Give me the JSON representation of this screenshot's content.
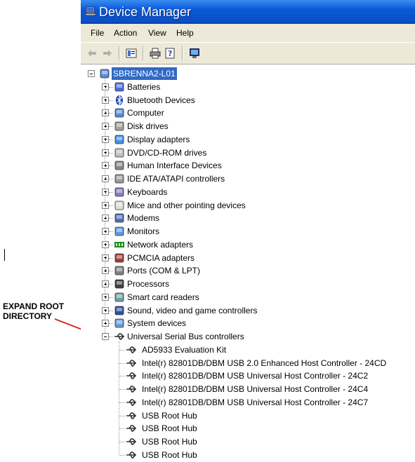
{
  "window": {
    "title": "Device Manager"
  },
  "menu": [
    "File",
    "Action",
    "View",
    "Help"
  ],
  "toolbar": [
    "back",
    "forward",
    "properties",
    "print",
    "help",
    "scan"
  ],
  "tree": {
    "root": "SBRENNA2-L01",
    "categories": [
      {
        "label": "Batteries",
        "icon": "battery-icon"
      },
      {
        "label": "Bluetooth Devices",
        "icon": "bluetooth-icon"
      },
      {
        "label": "Computer",
        "icon": "computer-icon"
      },
      {
        "label": "Disk drives",
        "icon": "disk-icon"
      },
      {
        "label": "Display adapters",
        "icon": "display-icon"
      },
      {
        "label": "DVD/CD-ROM drives",
        "icon": "dvd-icon"
      },
      {
        "label": "Human Interface Devices",
        "icon": "hid-icon"
      },
      {
        "label": "IDE ATA/ATAPI controllers",
        "icon": "ide-icon"
      },
      {
        "label": "Keyboards",
        "icon": "keyboard-icon"
      },
      {
        "label": "Mice and other pointing devices",
        "icon": "mouse-icon"
      },
      {
        "label": "Modems",
        "icon": "modem-icon"
      },
      {
        "label": "Monitors",
        "icon": "monitor-icon"
      },
      {
        "label": "Network adapters",
        "icon": "network-icon"
      },
      {
        "label": "PCMCIA adapters",
        "icon": "pcmcia-icon"
      },
      {
        "label": "Ports (COM & LPT)",
        "icon": "port-icon"
      },
      {
        "label": "Processors",
        "icon": "processor-icon"
      },
      {
        "label": "Smart card readers",
        "icon": "smartcard-icon"
      },
      {
        "label": "Sound, video and game controllers",
        "icon": "sound-icon"
      },
      {
        "label": "System devices",
        "icon": "system-icon"
      },
      {
        "label": "Universal Serial Bus controllers",
        "icon": "usb-icon"
      }
    ],
    "usb_children": [
      "AD5933 Evaluation Kit",
      "Intel(r) 82801DB/DBM USB 2.0 Enhanced Host Controller - 24CD",
      "Intel(r) 82801DB/DBM USB Universal Host Controller - 24C2",
      "Intel(r) 82801DB/DBM USB Universal Host Controller - 24C4",
      "Intel(r) 82801DB/DBM USB Universal Host Controller - 24C7",
      "USB Root Hub",
      "USB Root Hub",
      "USB Root Hub",
      "USB Root Hub"
    ]
  },
  "annotation": {
    "line1": "EXPAND ROOT",
    "line2": "DIRECTORY"
  },
  "colors": {
    "title_bar": "#0a58d8",
    "selection": "#316ac5",
    "highlight_ring": "#d9232a"
  }
}
